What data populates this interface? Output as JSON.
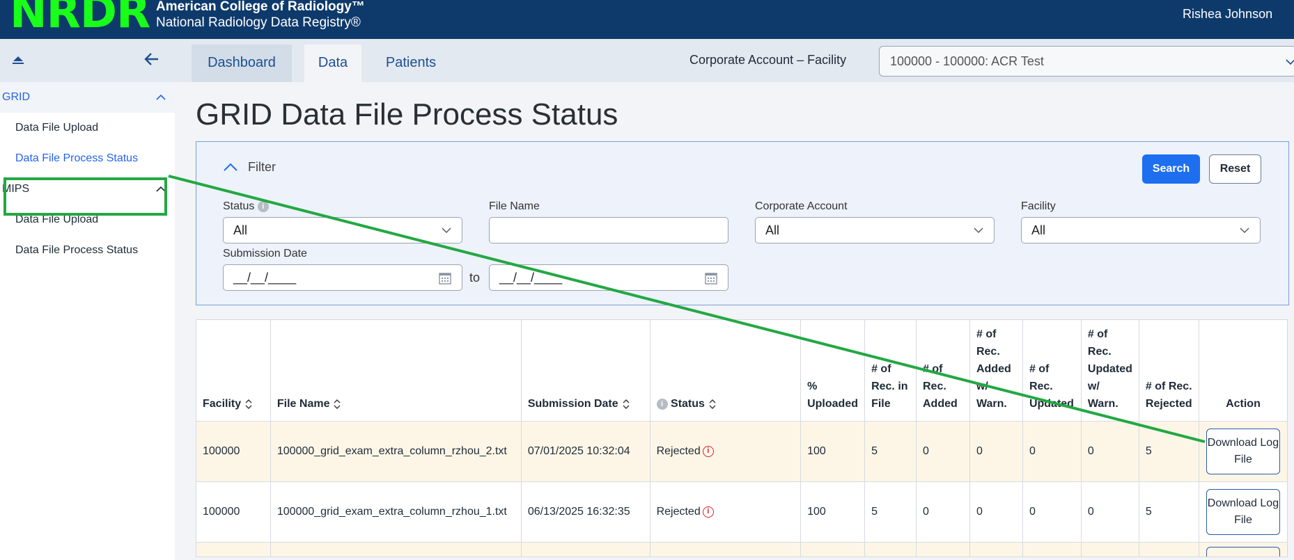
{
  "header": {
    "logo": "NRDR",
    "org_line1": "American College of Radiology™",
    "org_line2": "National Radiology Data Registry®",
    "user": "Rishea Johnson"
  },
  "sidebar": {
    "sections": [
      {
        "label": "GRID",
        "items": [
          {
            "label": "Data File Upload"
          },
          {
            "label": "Data File Process Status"
          }
        ]
      },
      {
        "label": "MIPS",
        "items": [
          {
            "label": "Data File Upload"
          },
          {
            "label": "Data File Process Status"
          }
        ]
      }
    ]
  },
  "tabs": [
    {
      "label": "Dashboard"
    },
    {
      "label": "Data"
    },
    {
      "label": "Patients"
    }
  ],
  "account": {
    "label": "Corporate Account – Facility",
    "selected": "100000 - 100000: ACR Test"
  },
  "page": {
    "title": "GRID Data File Process Status"
  },
  "filter": {
    "toggle_label": "Filter",
    "search_label": "Search",
    "reset_label": "Reset",
    "status": {
      "label": "Status",
      "value": "All"
    },
    "file_name": {
      "label": "File Name",
      "value": ""
    },
    "corporate_account": {
      "label": "Corporate Account",
      "value": "All"
    },
    "facility": {
      "label": "Facility",
      "value": "All"
    },
    "submission_date": {
      "label": "Submission Date",
      "from_placeholder": "__/__/____",
      "to_label": "to",
      "to_placeholder": "__/__/____"
    }
  },
  "table": {
    "columns": {
      "facility": "Facility",
      "file_name": "File Name",
      "submission_date": "Submission Date",
      "status": "Status",
      "pct_uploaded": "% Uploaded",
      "rec_in_file": "# of Rec. in File",
      "rec_added": "# of Rec. Added",
      "rec_added_warn": "# of Rec. Added w/ Warn.",
      "rec_updated": "# of Rec. Updated",
      "rec_updated_warn": "# of Rec. Updated w/ Warn.",
      "rec_rejected": "# of Rec. Rejected",
      "action": "Action"
    },
    "rows": [
      {
        "facility": "100000",
        "file_name": "100000_grid_exam_extra_column_rzhou_2.txt",
        "submission_date": "07/01/2025 10:32:04",
        "status": "Rejected",
        "pct_uploaded": "100",
        "rec_in_file": "5",
        "rec_added": "0",
        "rec_added_warn": "0",
        "rec_updated": "0",
        "rec_updated_warn": "0",
        "rec_rejected": "5",
        "action": "Download Log File"
      },
      {
        "facility": "100000",
        "file_name": "100000_grid_exam_extra_column_rzhou_1.txt",
        "submission_date": "06/13/2025 16:32:35",
        "status": "Rejected",
        "pct_uploaded": "100",
        "rec_in_file": "5",
        "rec_added": "0",
        "rec_added_warn": "0",
        "rec_updated": "0",
        "rec_updated_warn": "0",
        "rec_rejected": "5",
        "action": "Download Log File"
      }
    ]
  },
  "colors": {
    "header_bg": "#0e3a6b",
    "logo_green": "#1aff1a",
    "accent_blue": "#1e6ef0",
    "annotation_green": "#23a843",
    "error_red": "#d8232a"
  }
}
